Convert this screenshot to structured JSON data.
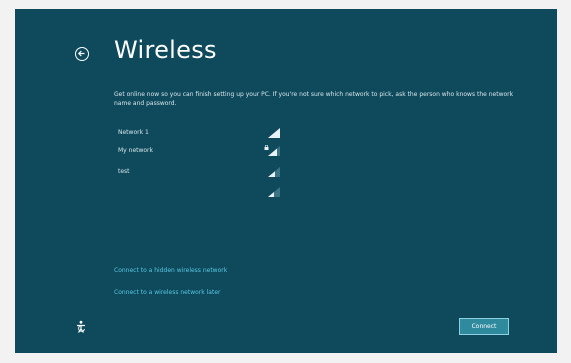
{
  "page": {
    "title": "Wireless",
    "description": "Get online now so you can finish setting up your PC. If you're not sure which network to pick, ask the person who knows the network name and password."
  },
  "networks": [
    {
      "name": "Network 1",
      "secured": false
    },
    {
      "name": "My network",
      "secured": true
    },
    {
      "name": "test",
      "secured": false
    },
    {
      "name": "",
      "secured": false
    }
  ],
  "links": {
    "hidden_network": "Connect to a hidden wireless network",
    "later": "Connect to a wireless network later"
  },
  "buttons": {
    "connect": "Connect"
  },
  "icons": {
    "back": "back-arrow-circle-icon",
    "signal": "wifi-signal-icon",
    "lock": "lock-icon",
    "ease_of_access": "ease-of-access-icon"
  },
  "colors": {
    "background": "#0e4a5c",
    "link": "#59c6e0",
    "button": "#2f8a9e"
  }
}
